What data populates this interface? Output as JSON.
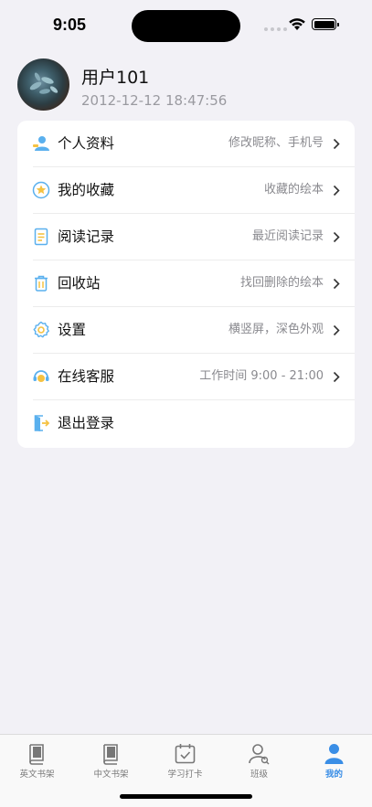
{
  "status_bar": {
    "time": "9:05"
  },
  "profile": {
    "name": "用户101",
    "date": "2012-12-12 18:47:56"
  },
  "menu": [
    {
      "label": "个人资料",
      "hint": "修改昵称、手机号",
      "icon": "person-icon"
    },
    {
      "label": "我的收藏",
      "hint": "收藏的绘本",
      "icon": "star-icon"
    },
    {
      "label": "阅读记录",
      "hint": "最近阅读记录",
      "icon": "document-icon"
    },
    {
      "label": "回收站",
      "hint": "找回删除的绘本",
      "icon": "trash-icon"
    },
    {
      "label": "设置",
      "hint": "横竖屏，深色外观",
      "icon": "gear-icon"
    },
    {
      "label": "在线客服",
      "hint": "工作时间 9:00 - 21:00",
      "icon": "headset-icon"
    },
    {
      "label": "退出登录",
      "hint": "",
      "icon": "logout-icon"
    }
  ],
  "tabs": [
    {
      "label": "英文书架",
      "icon": "book-icon",
      "active": false
    },
    {
      "label": "中文书架",
      "icon": "book-icon",
      "active": false
    },
    {
      "label": "学习打卡",
      "icon": "calendar-check-icon",
      "active": false
    },
    {
      "label": "班级",
      "icon": "class-icon",
      "active": false
    },
    {
      "label": "我的",
      "icon": "profile-icon",
      "active": true
    }
  ],
  "colors": {
    "accent": "#3a8ee6",
    "background": "#f2f1f6",
    "icon_blue": "#5ab0ee",
    "icon_yellow": "#f5c242"
  }
}
